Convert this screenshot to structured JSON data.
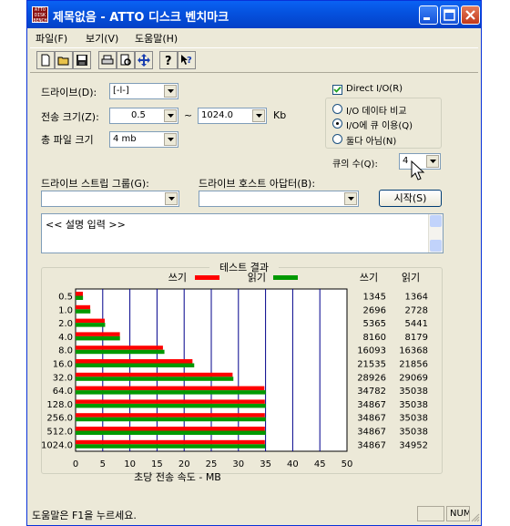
{
  "window": {
    "title": "제목없음 - ATTO 디스크 벤치마크",
    "icon_text": "ATTO DISK BENCH"
  },
  "menu": [
    "파일(F)",
    "보기(V)",
    "도움말(H)"
  ],
  "toolbar": {
    "icons": [
      "new-file-icon",
      "open-folder-icon",
      "save-icon",
      "print-icon",
      "print-preview-icon",
      "move-icon",
      "help-icon",
      "context-help-icon"
    ]
  },
  "form": {
    "drive_label": "드라이브(D):",
    "drive_value": "[-l-]",
    "transfer_size_label": "전송 크기(Z):",
    "transfer_from": "0.5",
    "transfer_sep": "~",
    "transfer_to": "1024.0",
    "transfer_unit": "Kb",
    "total_length_label": "총 파일 크기",
    "total_length_value": "4 mb",
    "direct_io_label": "Direct I/O(R)",
    "direct_io_checked": true,
    "radio_options": [
      "I/O 데이타 비교",
      "I/O에 큐 이용(Q)",
      "둘다 아님(N)"
    ],
    "radio_selected": 1,
    "queue_label": "큐의 수(Q):",
    "queue_value": "4",
    "stripe_label": "드라이브 스트립 그룹(G):",
    "stripe_value": "",
    "adapter_label": "드라이브 호스트 아답터(B):",
    "adapter_value": "",
    "start_button": "시작(S)",
    "description": "<< 설명 입력 >>"
  },
  "results": {
    "group_title": "테스트 결과",
    "legend_write": "쓰기",
    "legend_read": "읽기",
    "col_write": "쓰기",
    "col_read": "읽기",
    "write_color": "#ff0000",
    "read_color": "#009900",
    "grid_color": "#00008b"
  },
  "chart_data": {
    "type": "bar",
    "orientation": "horizontal",
    "categories": [
      "0.5",
      "1.0",
      "2.0",
      "4.0",
      "8.0",
      "16.0",
      "32.0",
      "64.0",
      "128.0",
      "256.0",
      "512.0",
      "1024.0"
    ],
    "series": [
      {
        "name": "쓰기",
        "values": [
          1345,
          2696,
          5365,
          8160,
          16093,
          21535,
          28926,
          34782,
          34867,
          34867,
          34867,
          34867
        ]
      },
      {
        "name": "읽기",
        "values": [
          1364,
          2728,
          5441,
          8179,
          16368,
          21856,
          29069,
          35038,
          35038,
          35038,
          35038,
          34952
        ]
      }
    ],
    "xlabel": "초당 전송 속도 - MB",
    "xticks": [
      0,
      5,
      10,
      15,
      20,
      25,
      30,
      35,
      40,
      45,
      50
    ],
    "xlim": [
      0,
      50
    ],
    "grid": true,
    "legend": "top"
  },
  "status": {
    "help_text": "도움말은 F1을 누르세요.",
    "num_indicator": "NUM"
  }
}
